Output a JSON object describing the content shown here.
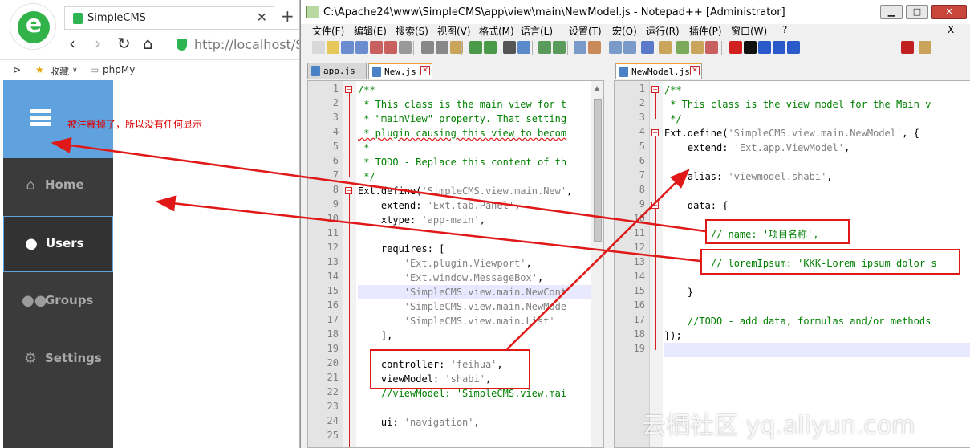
{
  "browser": {
    "tab_title": "SimpleCMS",
    "tab_close": "✕",
    "new_tab": "+",
    "logo_letter": "e",
    "nav": {
      "back": "‹",
      "forward": "›",
      "reload": "↻",
      "home": "⌂"
    },
    "address": "http://localhost/Si",
    "bookmarks": {
      "toggle": "⊳",
      "item1": "收藏",
      "item1_arrow": "∨",
      "item2": "phpMy"
    }
  },
  "app": {
    "note": "被注释掉了，所以没有任何显示",
    "nav_items": [
      {
        "label": "Home",
        "icon": "home-icon",
        "glyph": "⌂",
        "active": false
      },
      {
        "label": "Users",
        "icon": "user-icon",
        "glyph": "●",
        "active": true
      },
      {
        "label": "Groups",
        "icon": "users-icon",
        "glyph": "●●",
        "active": false
      },
      {
        "label": "Settings",
        "icon": "gear-icon",
        "glyph": "⚙",
        "active": false
      }
    ],
    "colors": {
      "nav_bg": "#3b3b3b",
      "toggle_bg": "#5fa2dd",
      "active_border": "#5fa2dd"
    }
  },
  "npp": {
    "title": "C:\\Apache24\\www\\SimpleCMS\\app\\view\\main\\NewModel.js - Notepad++ [Administrator]",
    "window_buttons": {
      "min": "▁",
      "max": "□",
      "close": "✕"
    },
    "menu": [
      "文件(F)",
      "编辑(E)",
      "搜索(S)",
      "视图(V)",
      "格式(M)",
      "语言(L)",
      "设置(T)",
      "宏(O)",
      "运行(R)",
      "插件(P)",
      "窗口(W)",
      "?",
      "X"
    ],
    "left_tabs": [
      {
        "name": "app.js",
        "active": false
      },
      {
        "name": "New.js",
        "active": true
      }
    ],
    "right_tabs": [
      {
        "name": "NewModel.js",
        "active": true
      }
    ],
    "left_lines": [
      [
        {
          "c": "c",
          "t": "/**"
        }
      ],
      [
        {
          "c": "c",
          "t": " * This class is the main view for t"
        }
      ],
      [
        {
          "c": "c",
          "t": " * \"mainView\" property. That setting"
        }
      ],
      [
        {
          "c": "c",
          "t": " * plugin causing this view to becom",
          "sq": true
        }
      ],
      [
        {
          "c": "c",
          "t": " *"
        }
      ],
      [
        {
          "c": "c",
          "t": " * TODO - Replace this content of th"
        }
      ],
      [
        {
          "c": "c",
          "t": " */"
        }
      ],
      [
        {
          "c": "t",
          "t": "Ext.define("
        },
        {
          "c": "s",
          "t": "'SimpleCMS.view.main.New'"
        },
        {
          "c": "t",
          "t": ","
        }
      ],
      [
        {
          "c": "t",
          "t": "    extend: "
        },
        {
          "c": "s",
          "t": "'Ext.tab.Panel'"
        },
        {
          "c": "t",
          "t": ","
        }
      ],
      [
        {
          "c": "t",
          "t": "    xtype: "
        },
        {
          "c": "s",
          "t": "'app-main'"
        },
        {
          "c": "t",
          "t": ","
        }
      ],
      [],
      [
        {
          "c": "t",
          "t": "    requires: ["
        }
      ],
      [
        {
          "c": "s",
          "t": "        'Ext.plugin.Viewport'"
        },
        {
          "c": "t",
          "t": ","
        }
      ],
      [
        {
          "c": "s",
          "t": "        'Ext.window.MessageBox'"
        },
        {
          "c": "t",
          "t": ","
        }
      ],
      [
        {
          "c": "s",
          "t": "        'SimpleCMS.view.main.NewCont"
        }
      ],
      [
        {
          "c": "s",
          "t": "        'SimpleCMS.view.main.NewMode"
        }
      ],
      [
        {
          "c": "s",
          "t": "        'SimpleCMS.view.main.List'"
        }
      ],
      [
        {
          "c": "t",
          "t": "    ],"
        }
      ],
      [],
      [
        {
          "c": "t",
          "t": "    controller: "
        },
        {
          "c": "s",
          "t": "'feihua'"
        },
        {
          "c": "t",
          "t": ","
        }
      ],
      [
        {
          "c": "t",
          "t": "    viewModel: "
        },
        {
          "c": "s",
          "t": "'shabi'"
        },
        {
          "c": "t",
          "t": ","
        }
      ],
      [
        {
          "c": "c",
          "t": "    //viewModel: 'SimpleCMS.view.mai"
        }
      ],
      [],
      [
        {
          "c": "t",
          "t": "    ui: "
        },
        {
          "c": "s",
          "t": "'navigation'"
        },
        {
          "c": "t",
          "t": ","
        }
      ],
      []
    ],
    "left_line_count": 25,
    "right_lines": [
      [
        {
          "c": "c",
          "t": "/**"
        }
      ],
      [
        {
          "c": "c",
          "t": " * This class is the view model for the Main v"
        }
      ],
      [
        {
          "c": "c",
          "t": " */"
        }
      ],
      [
        {
          "c": "t",
          "t": "Ext.define("
        },
        {
          "c": "s",
          "t": "'SimpleCMS.view.main.NewModel'"
        },
        {
          "c": "t",
          "t": ", {"
        }
      ],
      [
        {
          "c": "t",
          "t": "    extend: "
        },
        {
          "c": "s",
          "t": "'Ext.app.ViewModel'"
        },
        {
          "c": "t",
          "t": ","
        }
      ],
      [],
      [
        {
          "c": "t",
          "t": "    alias: "
        },
        {
          "c": "s",
          "t": "'viewmodel.shabi'"
        },
        {
          "c": "t",
          "t": ","
        }
      ],
      [],
      [
        {
          "c": "t",
          "t": "    data: {"
        }
      ],
      [],
      [
        {
          "c": "c",
          "t": "        // name: '项目名称',"
        }
      ],
      [],
      [
        {
          "c": "c",
          "t": "        // loremIpsum: 'KKK-Lorem ipsum dolor s"
        }
      ],
      [],
      [
        {
          "c": "t",
          "t": "    }"
        }
      ],
      [],
      [
        {
          "c": "c",
          "t": "    //TODO - add data, formulas and/or methods"
        }
      ],
      [
        {
          "c": "t",
          "t": "});"
        }
      ],
      []
    ],
    "right_line_count": 19
  },
  "watermark": "云栖社区 yq.aliyun.com",
  "annotation_color": "#e01818"
}
